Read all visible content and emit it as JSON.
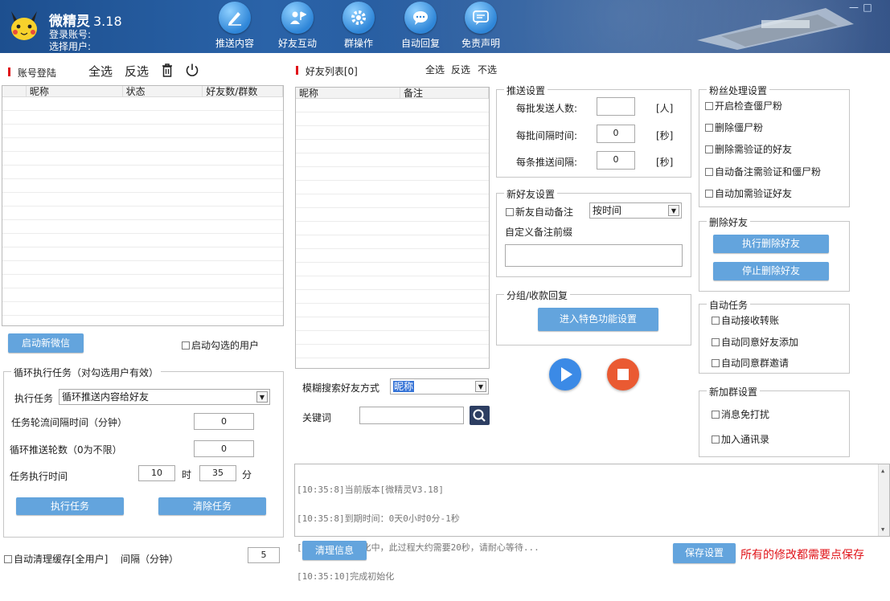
{
  "header": {
    "app_name": "微精灵",
    "version": "3.18",
    "login_account_label": "登录账号:",
    "select_user_label": "选择用户:",
    "nav": [
      {
        "label": "推送内容",
        "icon": "pen-icon"
      },
      {
        "label": "好友互动",
        "icon": "user-flag-icon"
      },
      {
        "label": "群操作",
        "icon": "gear-icon"
      },
      {
        "label": "自动回复",
        "icon": "chat-bubble-icon"
      },
      {
        "label": "免责声明",
        "icon": "message-lines-icon"
      }
    ],
    "minimize": "—",
    "maximize": "□"
  },
  "accounts": {
    "title": "账号登陆",
    "select_all": "全选",
    "invert": "反选",
    "columns": [
      "昵称",
      "状态",
      "好友数/群数"
    ],
    "start_wechat": "启动新微信",
    "start_selected": "启动勾选的用户"
  },
  "loop_task": {
    "title": "循环执行任务（对勾选用户有效）",
    "exec_task_label": "执行任务",
    "exec_task_value": "循环推送内容给好友",
    "interval_label": "任务轮流间隔时间（分钟）",
    "interval_value": "0",
    "rounds_label": "循环推送轮数（0为不限）",
    "rounds_value": "0",
    "time_label": "任务执行时间",
    "hour_value": "10",
    "hour_unit": "时",
    "minute_value": "35",
    "minute_unit": "分",
    "run_button": "执行任务",
    "clear_button": "清除任务"
  },
  "bottom_left": {
    "auto_clear_label": "自动清理缓存[全用户]",
    "interval_label": "间隔（分钟）",
    "interval_value": "5"
  },
  "friends": {
    "title": "好友列表[0]",
    "select_all": "全选",
    "invert": "反选",
    "select_none": "不选",
    "columns": [
      "昵称",
      "备注"
    ],
    "search_mode_label": "模糊搜索好友方式",
    "search_mode_value": "昵称",
    "keyword_label": "关键词",
    "keyword_value": ""
  },
  "push_settings": {
    "title": "推送设置",
    "per_batch_label": "每批发送人数:",
    "per_batch_value": "",
    "per_batch_unit": "[人]",
    "batch_interval_label": "每批间隔时间:",
    "batch_interval_value": "0",
    "batch_interval_unit": "[秒]",
    "item_interval_label": "每条推送间隔:",
    "item_interval_value": "0",
    "item_interval_unit": "[秒]"
  },
  "new_friend": {
    "title": "新好友设置",
    "auto_remark_label": "新友自动备注",
    "remark_mode_value": "按时间",
    "custom_prefix_label": "自定义备注前缀",
    "custom_prefix_value": ""
  },
  "group_reply": {
    "title": "分组/收款回复",
    "enter_button": "进入特色功能设置"
  },
  "fans": {
    "title": "粉丝处理设置",
    "options": [
      "开启检查僵尸粉",
      "删除僵尸粉",
      "删除需验证的好友",
      "自动备注需验证和僵尸粉",
      "自动加需验证好友"
    ]
  },
  "delete_friends": {
    "title": "删除好友",
    "exec_button": "执行删除好友",
    "stop_button": "停止删除好友"
  },
  "auto_tasks": {
    "title": "自动任务",
    "options": [
      "自动接收转账",
      "自动同意好友添加",
      "自动同意群邀请"
    ]
  },
  "new_group": {
    "title": "新加群设置",
    "options": [
      "消息免打扰",
      "加入通讯录"
    ]
  },
  "log": {
    "lines": [
      "[10:35:8]当前版本[微精灵V3.18]",
      "[10:35:8]到期时间：0天0小时0分-1秒",
      "[10:35:8]初始化中，此过程大约需要20秒，请耐心等待...",
      "[10:35:10]完成初始化"
    ],
    "clear_button": "清理信息"
  },
  "footer": {
    "save_button": "保存设置",
    "notice": "所有的修改都需要点保存"
  },
  "colors": {
    "accent": "#63a4dd",
    "notice_red": "#e0141a",
    "play_blue": "#3b8ae6",
    "stop_red": "#ea5a32"
  }
}
